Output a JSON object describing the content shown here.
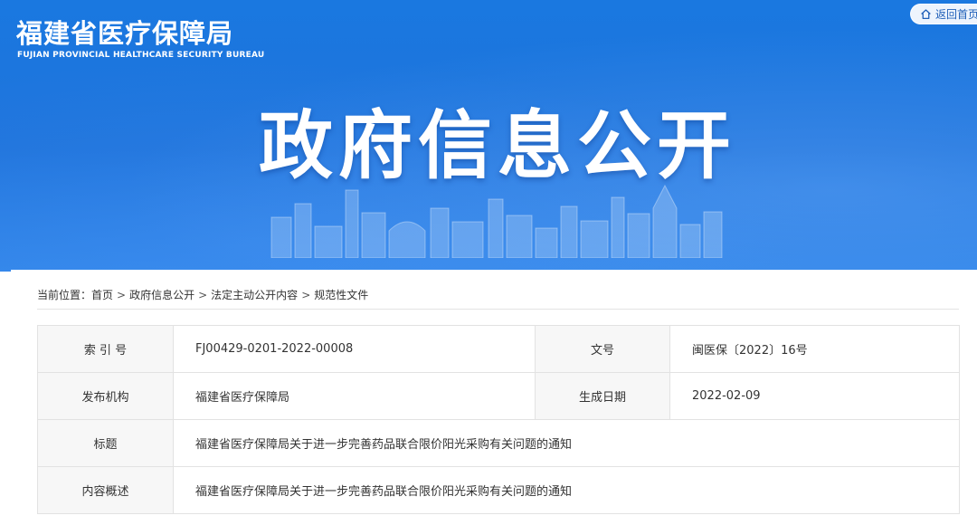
{
  "header": {
    "org_name_cn": "福建省医疗保障局",
    "org_name_en": "FUJIAN PROVINCIAL HEALTHCARE SECURITY BUREAU",
    "home_button_label": "返回首页",
    "home_icon": "home-icon",
    "banner_title": "政府信息公开"
  },
  "breadcrumb": {
    "prefix": "当前位置：",
    "items": [
      "首页",
      "政府信息公开",
      "法定主动公开内容",
      "规范性文件"
    ],
    "separator": ">"
  },
  "document_info": {
    "index_label": "索 引 号",
    "index_value": "FJ00429-0201-2022-00008",
    "doc_no_label": "文号",
    "doc_no_value": "闽医保〔2022〕16号",
    "issuer_label": "发布机构",
    "issuer_value": "福建省医疗保障局",
    "date_label": "生成日期",
    "date_value": "2022-02-09",
    "title_label": "标题",
    "title_value": "福建省医疗保障局关于进一步完善药品联合限价阳光采购有关问题的通知",
    "summary_label": "内容概述",
    "summary_value": "福建省医疗保障局关于进一步完善药品联合限价阳光采购有关问题的通知"
  },
  "colors": {
    "banner_blue": "#1e73db",
    "label_bg": "#f7f7f7",
    "border": "#e2e2e2"
  }
}
